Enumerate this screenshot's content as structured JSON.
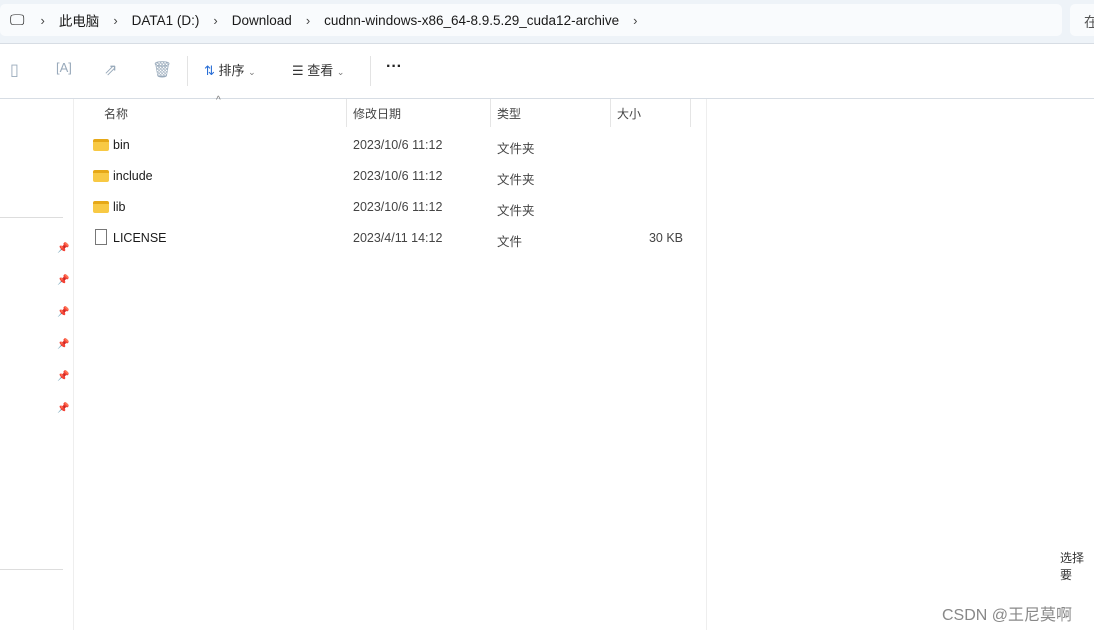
{
  "breadcrumb": [
    "此电脑",
    "DATA1 (D:)",
    "Download",
    "cudnn-windows-x86_64-8.9.5.29_cuda12-archive"
  ],
  "search_placeholder": "在",
  "toolbar": {
    "sort": "排序",
    "view": "查看",
    "more": "···"
  },
  "columns": [
    "名称",
    "修改日期",
    "类型",
    "大小"
  ],
  "files": [
    {
      "name": "bin",
      "date": "2023/10/6 11:12",
      "type": "文件夹",
      "size": "",
      "icon": "folder"
    },
    {
      "name": "include",
      "date": "2023/10/6 11:12",
      "type": "文件夹",
      "size": "",
      "icon": "folder"
    },
    {
      "name": "lib",
      "date": "2023/10/6 11:12",
      "type": "文件夹",
      "size": "",
      "icon": "folder"
    },
    {
      "name": "LICENSE",
      "date": "2023/4/11 14:12",
      "type": "文件",
      "size": "30 KB",
      "icon": "file"
    }
  ],
  "status": "选择要",
  "watermark": "CSDN @王尼莫啊"
}
